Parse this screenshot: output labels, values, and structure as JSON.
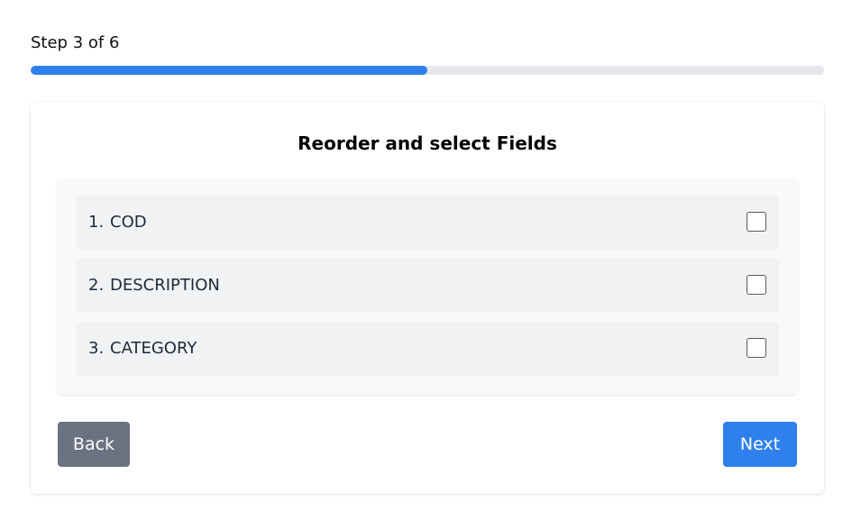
{
  "progress": {
    "step_label": "Step 3 of 6",
    "current_step": 3,
    "total_steps": 6,
    "fill_fraction": 0.5,
    "fill_color": "#2f80ed",
    "track_color": "#e5e7eb"
  },
  "card": {
    "title": "Reorder and select Fields",
    "fields": [
      {
        "number": "1.",
        "name": "COD",
        "checked": false
      },
      {
        "number": "2.",
        "name": "DESCRIPTION",
        "checked": false
      },
      {
        "number": "3.",
        "name": "CATEGORY",
        "checked": false
      }
    ],
    "back_label": "Back",
    "next_label": "Next"
  },
  "colors": {
    "primary": "#2f80ed",
    "secondary": "#6b7280"
  }
}
